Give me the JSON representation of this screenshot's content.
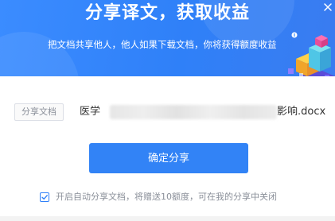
{
  "banner": {
    "title": "分享译文，获取收益",
    "subtitle": "把文档共享他人，他人如果下载文档，你将获得额度收益"
  },
  "file": {
    "tag": "分享文档",
    "name_prefix": "医学",
    "name_suffix": "影响.docx"
  },
  "actions": {
    "confirm_label": "确定分享"
  },
  "auto_share": {
    "checked": true,
    "label": "开启自动分享文档，将赠送10额度，可在我的分享中关闭"
  },
  "colors": {
    "accent": "#3283f6",
    "banner": "#2f80f8"
  }
}
